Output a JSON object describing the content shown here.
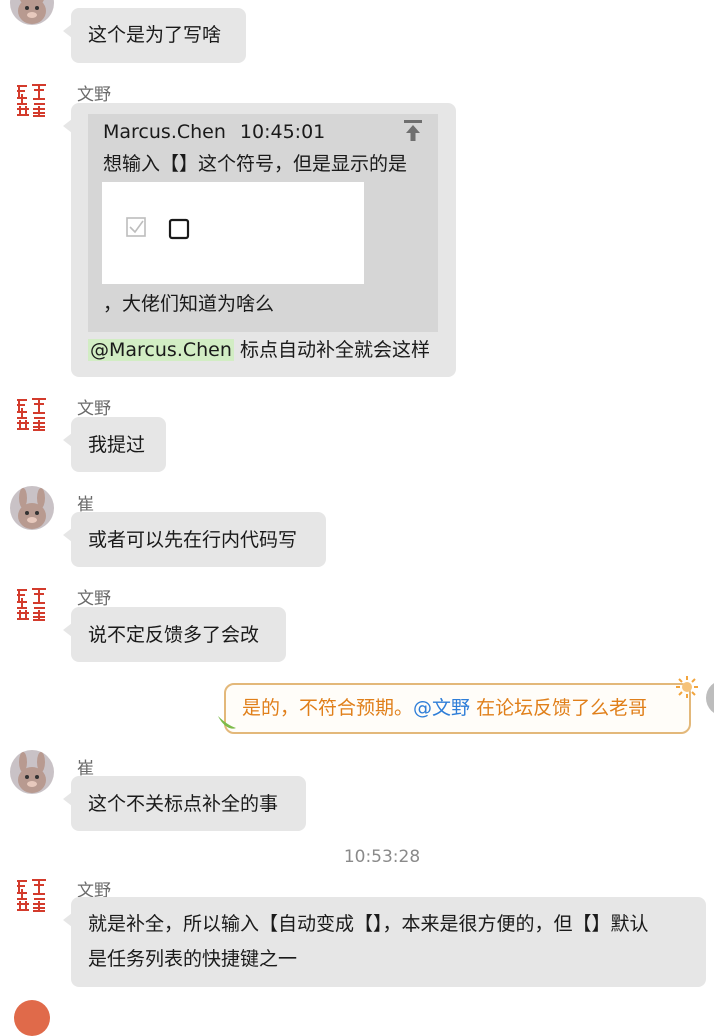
{
  "messages": {
    "m1": {
      "text": "这个是为了写啥"
    },
    "m2": {
      "sender": "文野",
      "quote": {
        "author": "Marcus.Chen",
        "time": "10:45:01",
        "line1": "想输入【】这个符号，但是显示的是",
        "line2": "，大佬们知道为啥么"
      },
      "mention": "@Marcus.Chen",
      "reply": " 标点自动补全就会这样"
    },
    "m3": {
      "sender": "文野",
      "text": "我提过"
    },
    "m4": {
      "sender": "崔",
      "text": "或者可以先在行内代码写"
    },
    "m5": {
      "sender": "文野",
      "text": "说不定反馈多了会改"
    },
    "m6": {
      "text_a": "是的，不符合预期。",
      "mention": "@文野",
      "text_b": "  在论坛反馈了么老哥"
    },
    "m7": {
      "sender": "崔",
      "text": "这个不关标点补全的事"
    },
    "timestamp": "10:53:28",
    "m8": {
      "sender": "文野",
      "line1": "就是补全，所以输入【自动变成【】，本来是很方便的，但【】默认",
      "line2": "是任务列表的快捷键之一"
    }
  },
  "icons": {
    "avatar_cui": "bunny-avatar-icon",
    "avatar_wenye": "red-seal-avatar-icon",
    "pin": "pin-top-icon",
    "checkbox_checked": "checkbox-checked-icon",
    "checkbox_empty": "checkbox-empty-icon",
    "sticker": "sun-sticker-icon"
  },
  "colors": {
    "bubble": "#e6e6e6",
    "quote_bg": "#d6d6d6",
    "mention_bg": "#d2edc4",
    "self_border": "#e3b87a",
    "self_text": "#e07f1a",
    "link": "#2f7ed8",
    "seal_red": "#d33b2c"
  }
}
